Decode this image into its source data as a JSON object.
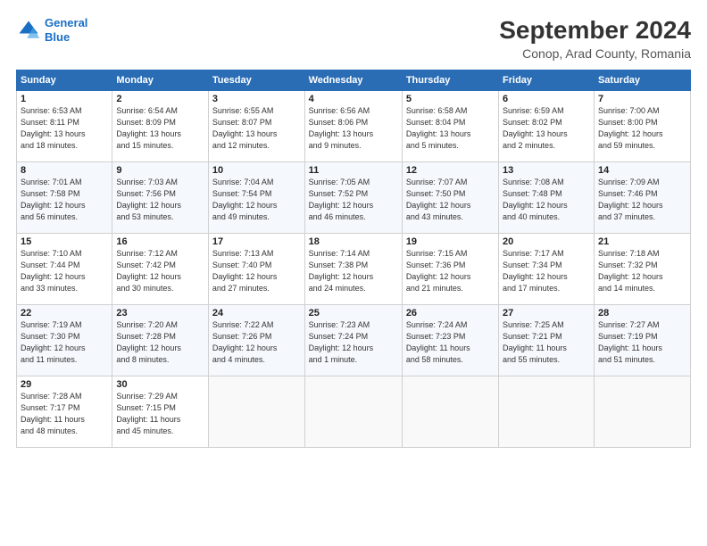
{
  "header": {
    "logo_line1": "General",
    "logo_line2": "Blue",
    "title": "September 2024",
    "subtitle": "Conop, Arad County, Romania"
  },
  "weekdays": [
    "Sunday",
    "Monday",
    "Tuesday",
    "Wednesday",
    "Thursday",
    "Friday",
    "Saturday"
  ],
  "weeks": [
    [
      {
        "day": "1",
        "info": "Sunrise: 6:53 AM\nSunset: 8:11 PM\nDaylight: 13 hours\nand 18 minutes."
      },
      {
        "day": "2",
        "info": "Sunrise: 6:54 AM\nSunset: 8:09 PM\nDaylight: 13 hours\nand 15 minutes."
      },
      {
        "day": "3",
        "info": "Sunrise: 6:55 AM\nSunset: 8:07 PM\nDaylight: 13 hours\nand 12 minutes."
      },
      {
        "day": "4",
        "info": "Sunrise: 6:56 AM\nSunset: 8:06 PM\nDaylight: 13 hours\nand 9 minutes."
      },
      {
        "day": "5",
        "info": "Sunrise: 6:58 AM\nSunset: 8:04 PM\nDaylight: 13 hours\nand 5 minutes."
      },
      {
        "day": "6",
        "info": "Sunrise: 6:59 AM\nSunset: 8:02 PM\nDaylight: 13 hours\nand 2 minutes."
      },
      {
        "day": "7",
        "info": "Sunrise: 7:00 AM\nSunset: 8:00 PM\nDaylight: 12 hours\nand 59 minutes."
      }
    ],
    [
      {
        "day": "8",
        "info": "Sunrise: 7:01 AM\nSunset: 7:58 PM\nDaylight: 12 hours\nand 56 minutes."
      },
      {
        "day": "9",
        "info": "Sunrise: 7:03 AM\nSunset: 7:56 PM\nDaylight: 12 hours\nand 53 minutes."
      },
      {
        "day": "10",
        "info": "Sunrise: 7:04 AM\nSunset: 7:54 PM\nDaylight: 12 hours\nand 49 minutes."
      },
      {
        "day": "11",
        "info": "Sunrise: 7:05 AM\nSunset: 7:52 PM\nDaylight: 12 hours\nand 46 minutes."
      },
      {
        "day": "12",
        "info": "Sunrise: 7:07 AM\nSunset: 7:50 PM\nDaylight: 12 hours\nand 43 minutes."
      },
      {
        "day": "13",
        "info": "Sunrise: 7:08 AM\nSunset: 7:48 PM\nDaylight: 12 hours\nand 40 minutes."
      },
      {
        "day": "14",
        "info": "Sunrise: 7:09 AM\nSunset: 7:46 PM\nDaylight: 12 hours\nand 37 minutes."
      }
    ],
    [
      {
        "day": "15",
        "info": "Sunrise: 7:10 AM\nSunset: 7:44 PM\nDaylight: 12 hours\nand 33 minutes."
      },
      {
        "day": "16",
        "info": "Sunrise: 7:12 AM\nSunset: 7:42 PM\nDaylight: 12 hours\nand 30 minutes."
      },
      {
        "day": "17",
        "info": "Sunrise: 7:13 AM\nSunset: 7:40 PM\nDaylight: 12 hours\nand 27 minutes."
      },
      {
        "day": "18",
        "info": "Sunrise: 7:14 AM\nSunset: 7:38 PM\nDaylight: 12 hours\nand 24 minutes."
      },
      {
        "day": "19",
        "info": "Sunrise: 7:15 AM\nSunset: 7:36 PM\nDaylight: 12 hours\nand 21 minutes."
      },
      {
        "day": "20",
        "info": "Sunrise: 7:17 AM\nSunset: 7:34 PM\nDaylight: 12 hours\nand 17 minutes."
      },
      {
        "day": "21",
        "info": "Sunrise: 7:18 AM\nSunset: 7:32 PM\nDaylight: 12 hours\nand 14 minutes."
      }
    ],
    [
      {
        "day": "22",
        "info": "Sunrise: 7:19 AM\nSunset: 7:30 PM\nDaylight: 12 hours\nand 11 minutes."
      },
      {
        "day": "23",
        "info": "Sunrise: 7:20 AM\nSunset: 7:28 PM\nDaylight: 12 hours\nand 8 minutes."
      },
      {
        "day": "24",
        "info": "Sunrise: 7:22 AM\nSunset: 7:26 PM\nDaylight: 12 hours\nand 4 minutes."
      },
      {
        "day": "25",
        "info": "Sunrise: 7:23 AM\nSunset: 7:24 PM\nDaylight: 12 hours\nand 1 minute."
      },
      {
        "day": "26",
        "info": "Sunrise: 7:24 AM\nSunset: 7:23 PM\nDaylight: 11 hours\nand 58 minutes."
      },
      {
        "day": "27",
        "info": "Sunrise: 7:25 AM\nSunset: 7:21 PM\nDaylight: 11 hours\nand 55 minutes."
      },
      {
        "day": "28",
        "info": "Sunrise: 7:27 AM\nSunset: 7:19 PM\nDaylight: 11 hours\nand 51 minutes."
      }
    ],
    [
      {
        "day": "29",
        "info": "Sunrise: 7:28 AM\nSunset: 7:17 PM\nDaylight: 11 hours\nand 48 minutes."
      },
      {
        "day": "30",
        "info": "Sunrise: 7:29 AM\nSunset: 7:15 PM\nDaylight: 11 hours\nand 45 minutes."
      },
      {
        "day": "",
        "info": ""
      },
      {
        "day": "",
        "info": ""
      },
      {
        "day": "",
        "info": ""
      },
      {
        "day": "",
        "info": ""
      },
      {
        "day": "",
        "info": ""
      }
    ]
  ]
}
